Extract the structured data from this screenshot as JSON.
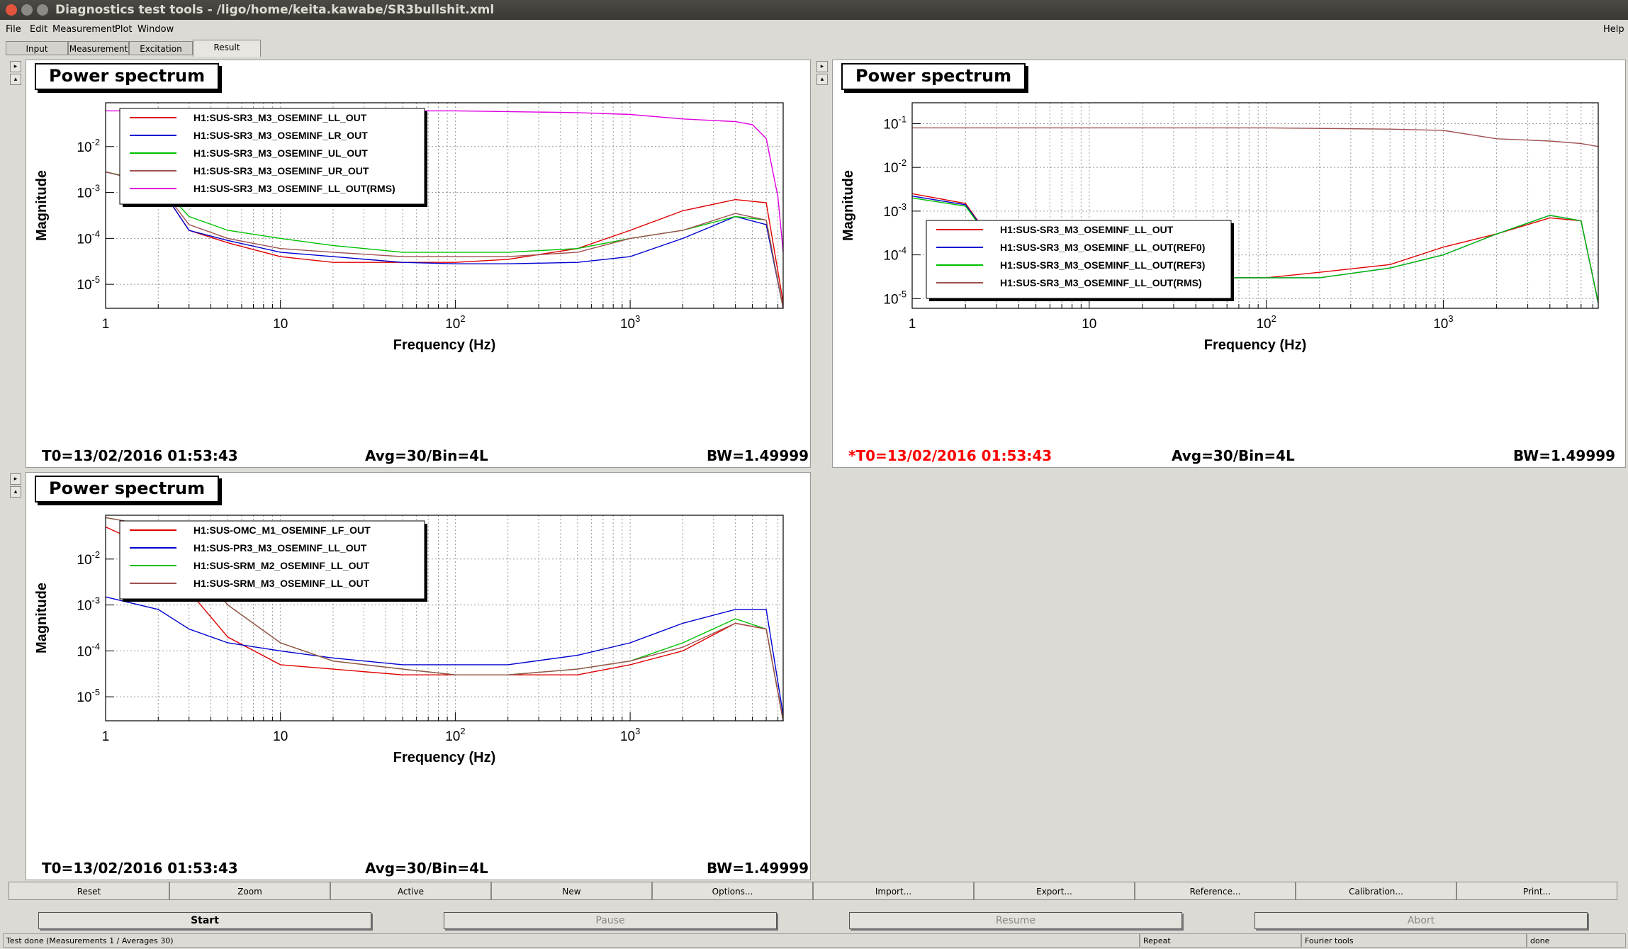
{
  "window": {
    "title": "Diagnostics test tools - /ligo/home/keita.kawabe/SR3bullshit.xml"
  },
  "menu": {
    "file": "File",
    "edit": "Edit",
    "measurement": "Measurement",
    "plot": "Plot",
    "window": "Window",
    "help": "Help"
  },
  "tabs": [
    "Input",
    "Measurement",
    "Excitation",
    "Result"
  ],
  "plots": [
    {
      "title": "Power spectrum",
      "ylabel": "Magnitude",
      "xlabel": "Frequency (Hz)",
      "t0": "T0=13/02/2016 01:53:43",
      "avg": "Avg=30/Bin=4L",
      "bw": "BW=1.49999",
      "legend": [
        "H1:SUS-SR3_M3_OSEMINF_LL_OUT",
        "H1:SUS-SR3_M3_OSEMINF_LR_OUT",
        "H1:SUS-SR3_M3_OSEMINF_UL_OUT",
        "H1:SUS-SR3_M3_OSEMINF_UR_OUT",
        "H1:SUS-SR3_M3_OSEMINF_LL_OUT(RMS)"
      ],
      "legend_colors": [
        "#e00000",
        "#0000d0",
        "#00c000",
        "#a05050",
        "#e000e0"
      ]
    },
    {
      "title": "Power spectrum",
      "ylabel": "Magnitude",
      "xlabel": "Frequency (Hz)",
      "t0": "*T0=13/02/2016 01:53:43",
      "avg": "Avg=30/Bin=4L",
      "bw": "BW=1.49999",
      "legend": [
        "H1:SUS-SR3_M3_OSEMINF_LL_OUT",
        "H1:SUS-SR3_M3_OSEMINF_LL_OUT(REF0)",
        "H1:SUS-SR3_M3_OSEMINF_LL_OUT(REF3)",
        "H1:SUS-SR3_M3_OSEMINF_LL_OUT(RMS)"
      ],
      "legend_colors": [
        "#e00000",
        "#0000d0",
        "#00c000",
        "#a05050"
      ]
    },
    {
      "title": "Power spectrum",
      "ylabel": "Magnitude",
      "xlabel": "Frequency (Hz)",
      "t0": "T0=13/02/2016 01:53:43",
      "avg": "Avg=30/Bin=4L",
      "bw": "BW=1.49999",
      "legend": [
        "H1:SUS-OMC_M1_OSEMINF_LF_OUT",
        "H1:SUS-PR3_M3_OSEMINF_LL_OUT",
        "H1:SUS-SRM_M2_OSEMINF_LL_OUT",
        "H1:SUS-SRM_M3_OSEMINF_LL_OUT"
      ],
      "legend_colors": [
        "#e00000",
        "#0000d0",
        "#00c000",
        "#a05050"
      ]
    }
  ],
  "chart_data": [
    {
      "type": "line",
      "title": "Power spectrum",
      "xlabel": "Frequency (Hz)",
      "ylabel": "Magnitude",
      "xscale": "log",
      "yscale": "log",
      "xlim": [
        1,
        7500
      ],
      "ylim": [
        3e-06,
        0.09
      ],
      "grid": true,
      "legend_position": "top-left",
      "x_ticks": [
        "1",
        "10",
        "10^2",
        "10^3"
      ],
      "y_ticks": [
        "10^-5",
        "10^-4",
        "10^-3",
        "10^-2"
      ],
      "series": [
        {
          "name": "H1:SUS-SR3_M3_OSEMINF_LL_OUT",
          "x": [
            1,
            2,
            3,
            5,
            10,
            20,
            50,
            100,
            200,
            500,
            1000,
            2000,
            4000,
            6000,
            7500
          ],
          "y": [
            0.0028,
            0.0015,
            0.00015,
            8e-05,
            4e-05,
            3e-05,
            3e-05,
            3e-05,
            3.5e-05,
            6e-05,
            0.00015,
            0.0004,
            0.0007,
            0.0006,
            4e-06
          ]
        },
        {
          "name": "H1:SUS-SR3_M3_OSEMINF_LR_OUT",
          "x": [
            1,
            2,
            3,
            5,
            10,
            20,
            50,
            100,
            200,
            500,
            1000,
            2000,
            4000,
            6000,
            7500
          ],
          "y": [
            0.0028,
            0.0015,
            0.00015,
            9e-05,
            5e-05,
            4e-05,
            3e-05,
            2.8e-05,
            2.8e-05,
            3e-05,
            4e-05,
            0.0001,
            0.0003,
            0.0002,
            3e-06
          ]
        },
        {
          "name": "H1:SUS-SR3_M3_OSEMINF_UL_OUT",
          "x": [
            1,
            2,
            3,
            5,
            10,
            20,
            50,
            100,
            200,
            500,
            1000,
            2000,
            4000,
            6000,
            7500
          ],
          "y": [
            0.0028,
            0.0016,
            0.0003,
            0.00015,
            0.0001,
            7e-05,
            5e-05,
            5e-05,
            5e-05,
            6e-05,
            0.0001,
            0.00015,
            0.0003,
            0.00025,
            3e-06
          ]
        },
        {
          "name": "H1:SUS-SR3_M3_OSEMINF_UR_OUT",
          "x": [
            1,
            2,
            3,
            5,
            10,
            20,
            50,
            100,
            200,
            500,
            1000,
            2000,
            4000,
            6000,
            7500
          ],
          "y": [
            0.0028,
            0.0015,
            0.0002,
            0.0001,
            6e-05,
            5e-05,
            4e-05,
            4e-05,
            4e-05,
            5e-05,
            0.0001,
            0.00015,
            0.00035,
            0.00025,
            3e-06
          ]
        },
        {
          "name": "H1:SUS-SR3_M3_OSEMINF_LL_OUT(RMS)",
          "x": [
            1,
            10,
            100,
            500,
            1000,
            2000,
            4000,
            5000,
            6000,
            7000,
            7500
          ],
          "y": [
            0.06,
            0.06,
            0.06,
            0.055,
            0.05,
            0.04,
            0.035,
            0.03,
            0.015,
            0.0008,
            5e-05
          ]
        }
      ]
    },
    {
      "type": "line",
      "title": "Power spectrum",
      "xlabel": "Frequency (Hz)",
      "ylabel": "Magnitude",
      "xscale": "log",
      "yscale": "log",
      "xlim": [
        1,
        7500
      ],
      "ylim": [
        6e-06,
        0.3
      ],
      "grid": true,
      "legend_position": "bottom-left",
      "x_ticks": [
        "1",
        "10",
        "10^2",
        "10^3"
      ],
      "y_ticks": [
        "10^-5",
        "10^-4",
        "10^-3",
        "10^-2",
        "10^-1"
      ],
      "series": [
        {
          "name": "H1:SUS-SR3_M3_OSEMINF_LL_OUT",
          "x": [
            1,
            2,
            3,
            5,
            10,
            20,
            50,
            100,
            200,
            500,
            1000,
            2000,
            4000,
            6000,
            7500
          ],
          "y": [
            0.0025,
            0.0015,
            0.00015,
            8e-05,
            4e-05,
            3e-05,
            3e-05,
            3e-05,
            4e-05,
            6e-05,
            0.00015,
            0.0003,
            0.0007,
            0.0006,
            8e-06
          ]
        },
        {
          "name": "H1:SUS-SR3_M3_OSEMINF_LL_OUT(REF0)",
          "x": [
            1,
            2,
            3,
            5,
            10,
            20,
            50,
            100,
            200,
            500,
            1000,
            2000,
            4000,
            6000,
            7500
          ],
          "y": [
            0.0022,
            0.0014,
            0.00015,
            8e-05,
            4e-05,
            3e-05,
            3e-05,
            3e-05,
            3e-05,
            5e-05,
            0.0001,
            0.0003,
            0.0008,
            0.0006,
            8e-06
          ]
        },
        {
          "name": "H1:SUS-SR3_M3_OSEMINF_LL_OUT(REF3)",
          "x": [
            1,
            2,
            3,
            5,
            10,
            20,
            50,
            100,
            200,
            500,
            1000,
            2000,
            4000,
            6000,
            7500
          ],
          "y": [
            0.002,
            0.0013,
            0.00014,
            8e-05,
            4e-05,
            3e-05,
            3e-05,
            3e-05,
            3e-05,
            5e-05,
            0.0001,
            0.0003,
            0.0008,
            0.0006,
            8e-06
          ]
        },
        {
          "name": "H1:SUS-SR3_M3_OSEMINF_LL_OUT(RMS)",
          "x": [
            1,
            10,
            100,
            500,
            1000,
            2000,
            4000,
            6000,
            7500
          ],
          "y": [
            0.08,
            0.08,
            0.08,
            0.075,
            0.07,
            0.045,
            0.04,
            0.035,
            0.03
          ]
        }
      ]
    },
    {
      "type": "line",
      "title": "Power spectrum",
      "xlabel": "Frequency (Hz)",
      "ylabel": "Magnitude",
      "xscale": "log",
      "yscale": "log",
      "xlim": [
        1,
        7500
      ],
      "ylim": [
        3e-06,
        0.09
      ],
      "grid": true,
      "legend_position": "top-left",
      "x_ticks": [
        "1",
        "10",
        "10^2",
        "10^3"
      ],
      "y_ticks": [
        "10^-5",
        "10^-4",
        "10^-3",
        "10^-2"
      ],
      "series": [
        {
          "name": "H1:SUS-OMC_M1_OSEMINF_LF_OUT",
          "x": [
            1,
            2,
            3,
            5,
            10,
            20,
            50,
            100,
            200,
            500,
            1000,
            2000,
            4000,
            6000,
            7500
          ],
          "y": [
            0.05,
            0.015,
            0.002,
            0.0002,
            5e-05,
            4e-05,
            3e-05,
            3e-05,
            3e-05,
            3e-05,
            5e-05,
            0.0001,
            0.0004,
            0.0003,
            3e-06
          ]
        },
        {
          "name": "H1:SUS-PR3_M3_OSEMINF_LL_OUT",
          "x": [
            1,
            2,
            3,
            5,
            10,
            20,
            50,
            100,
            200,
            500,
            1000,
            2000,
            4000,
            6000,
            7500
          ],
          "y": [
            0.0015,
            0.0008,
            0.0003,
            0.00015,
            0.0001,
            7e-05,
            5e-05,
            5e-05,
            5e-05,
            8e-05,
            0.00015,
            0.0004,
            0.0008,
            0.0008,
            4e-06
          ]
        },
        {
          "name": "H1:SUS-SRM_M2_OSEMINF_LL_OUT",
          "x": [
            1,
            2,
            3,
            5,
            10,
            20,
            50,
            100,
            200,
            500,
            1000,
            2000,
            4000,
            6000,
            7500
          ],
          "y": [
            0.08,
            0.05,
            0.01,
            0.001,
            0.00015,
            6e-05,
            4e-05,
            3e-05,
            3e-05,
            4e-05,
            6e-05,
            0.00015,
            0.0005,
            0.0003,
            3e-06
          ]
        },
        {
          "name": "H1:SUS-SRM_M3_OSEMINF_LL_OUT",
          "x": [
            1,
            2,
            3,
            5,
            10,
            20,
            50,
            100,
            200,
            500,
            1000,
            2000,
            4000,
            6000,
            7500
          ],
          "y": [
            0.08,
            0.05,
            0.01,
            0.001,
            0.00015,
            6e-05,
            4e-05,
            3e-05,
            3e-05,
            4e-05,
            6e-05,
            0.00012,
            0.0004,
            0.0003,
            3e-06
          ]
        }
      ]
    }
  ],
  "buttons": [
    "Reset",
    "Zoom",
    "Active",
    "New",
    "Options...",
    "Import...",
    "Export...",
    "Reference...",
    "Calibration...",
    "Print..."
  ],
  "actions": [
    "Start",
    "Pause",
    "Resume",
    "Abort"
  ],
  "status": {
    "message": "Test done (Measurements 1 / Averages 30)",
    "mode": "Repeat",
    "tool": "Fourier tools",
    "state": "done"
  }
}
